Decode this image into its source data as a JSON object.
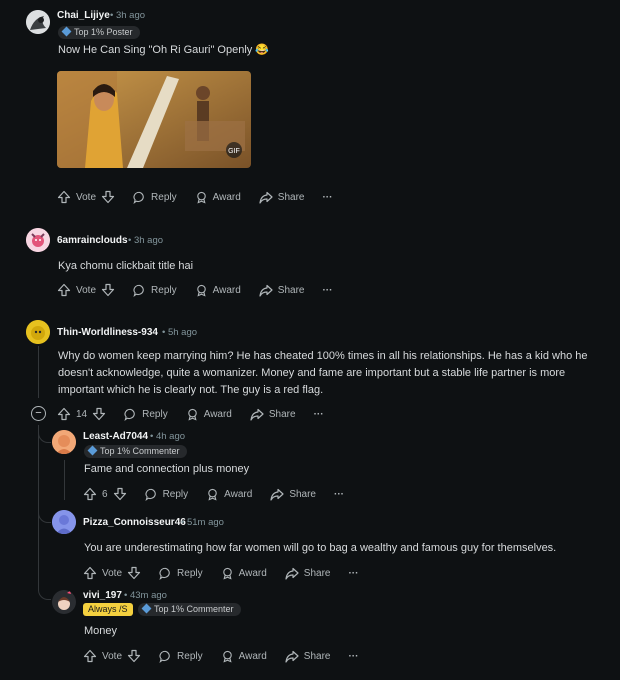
{
  "comments": [
    {
      "user": "Chai_Lijiye",
      "time": "3h ago",
      "badges": [
        "Top 1% Poster"
      ],
      "text": "Now He Can Sing \"Oh Ri Gauri\" Openly 😂",
      "gif_label": "GIF",
      "actions": {
        "vote": "Vote",
        "reply": "Reply",
        "award": "Award",
        "share": "Share",
        "more": "···"
      }
    },
    {
      "user": "6amrainclouds",
      "time": "3h ago",
      "text": "Kya chomu clickbait title hai",
      "actions": {
        "vote": "Vote",
        "reply": "Reply",
        "award": "Award",
        "share": "Share",
        "more": "···"
      }
    },
    {
      "user": "Thin-Worldliness-934",
      "time": "5h ago",
      "text": "Why do women keep marrying him? He has cheated 100% times in all his relationships. He has a kid who he doesn't acknowledge, quite a womanizer. Money and fame are important but a stable life partner is more important which he is clearly not. The guy is a red flag.",
      "actions": {
        "vote": "14",
        "reply": "Reply",
        "award": "Award",
        "share": "Share",
        "more": "···"
      },
      "collapse": "−"
    },
    {
      "user": "Least-Ad7044",
      "time": "4h ago",
      "badges": [
        "Top 1% Commenter"
      ],
      "text": "Fame and connection plus money",
      "actions": {
        "vote": "6",
        "reply": "Reply",
        "award": "Award",
        "share": "Share",
        "more": "···"
      }
    },
    {
      "user": "Pizza_Connoisseur46",
      "time": "51m ago",
      "text": "You are underestimating how far women will go to bag a wealthy and famous guy for themselves.",
      "actions": {
        "vote": "Vote",
        "reply": "Reply",
        "award": "Award",
        "share": "Share",
        "more": "···"
      }
    },
    {
      "user": "vivi_197",
      "time": "43m ago",
      "flair": "Always /S",
      "badges": [
        "Top 1% Commenter"
      ],
      "text": "Money",
      "actions": {
        "vote": "Vote",
        "reply": "Reply",
        "award": "Award",
        "share": "Share",
        "more": "···"
      }
    }
  ],
  "sep": "•",
  "colors": {
    "bg": "#0e1113",
    "text": "#d7dadc",
    "meta": "#82959b",
    "flair": "#f4d03f"
  }
}
